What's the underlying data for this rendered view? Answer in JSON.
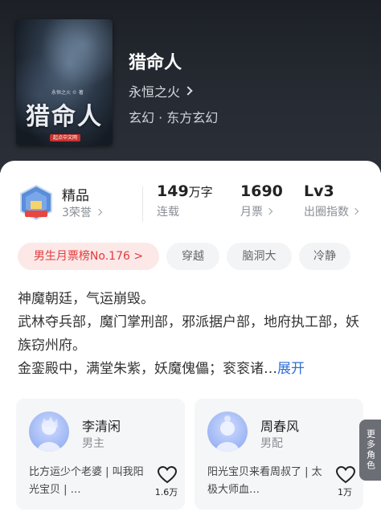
{
  "book": {
    "title": "猎命人",
    "author": "永恒之火",
    "genre": "玄幻 · 东方玄幻",
    "cover": {
      "title": "猎命人",
      "author_line": "永恒之火 © 著",
      "badge": "起点中文网"
    }
  },
  "stats": {
    "quality_title": "精品",
    "honors": "3荣誉",
    "words_value": "149",
    "words_unit": "万字",
    "words_label": "连载",
    "tickets_value": "1690",
    "tickets_label": "月票",
    "level_value": "Lv3",
    "level_label": "出圈指数"
  },
  "tags": {
    "rank": "男生月票榜No.176 >",
    "t1": "穿越",
    "t2": "脑洞大",
    "t3": "冷静"
  },
  "synopsis": {
    "line1": "神魔朝廷，气运崩毁。",
    "line2": "武林夺兵部，魔门掌刑部，邪派据户部，地府执工部，妖族窃州府。",
    "line3": "金銮殿中，满堂朱紫，妖魔傀儡；衮衮诸…",
    "expand": "展开"
  },
  "characters": [
    {
      "name": "李清闲",
      "role": "男主",
      "quote": "比方运少个老婆 | 叫我阳光宝贝 | …",
      "likes": "1.6万"
    },
    {
      "name": "周春风",
      "role": "男配",
      "quote": "阳光宝贝来看周叔了 | 太极大师血…",
      "likes": "1万"
    }
  ],
  "side_tab": "更多角色",
  "colors": {
    "header_bg": "#262b33",
    "accent_link": "#2f6fd6",
    "hot_tag_text": "#e03c3c",
    "hot_tag_bg": "#fde8e8"
  }
}
